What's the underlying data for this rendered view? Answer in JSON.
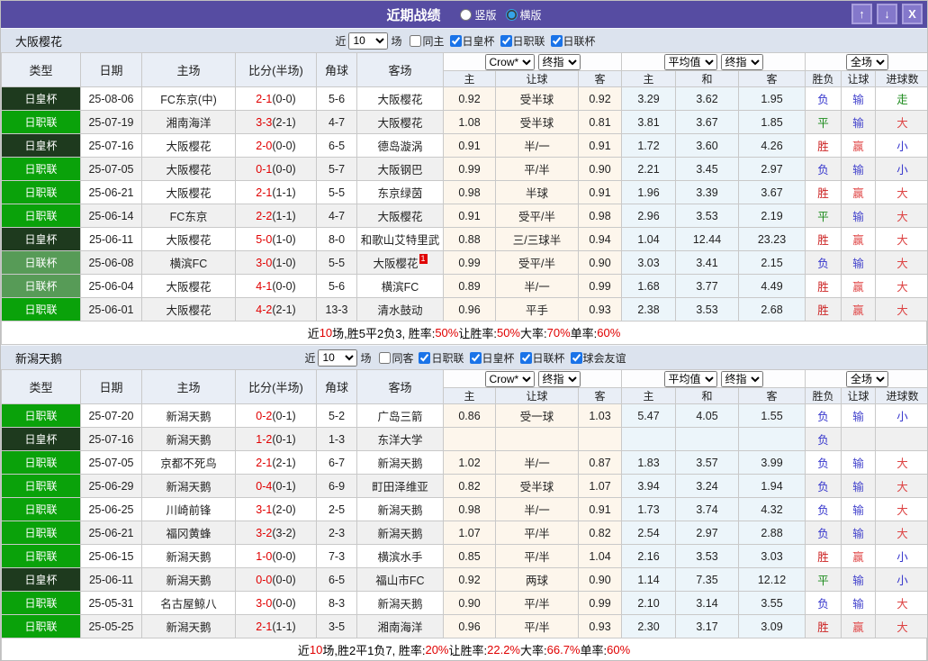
{
  "titlebar": {
    "title": "近期战绩",
    "radios": [
      {
        "label": "竖版",
        "checked": false
      },
      {
        "label": "横版",
        "checked": true
      }
    ],
    "buttons": [
      {
        "glyph": "↑"
      },
      {
        "glyph": "↓"
      },
      {
        "glyph": "X"
      }
    ]
  },
  "colors": {
    "titlebar_bg": "#564ca2",
    "teambar_bg": "#dce3ee",
    "header_bg": "#e9eef6",
    "stripe": "#f0f0f0",
    "handicap_bg": "#fdf6ec",
    "average_bg": "#ecf5fa",
    "self_team": "#008000",
    "score_red": "#e00000",
    "league": {
      "日职联": "#0aa20a",
      "日皇杯": "#1e3a1e",
      "日联杯": "#579b57"
    },
    "outcome": {
      "胜": "#cc2222",
      "平": "#1a8a1a",
      "负": "#3333cc",
      "赢": "#e04848",
      "输": "#4444cc",
      "走": "#1a8a1a",
      "大": "#dd4444",
      "小": "#3333cc"
    }
  },
  "tables": [
    {
      "team": "大阪樱花",
      "filter": {
        "prefix": "近",
        "count": "10",
        "suffix": "场",
        "same": {
          "label": "同主",
          "checked": false
        },
        "leagues": [
          {
            "label": "日皇杯",
            "checked": true
          },
          {
            "label": "日职联",
            "checked": true
          },
          {
            "label": "日联杯",
            "checked": true
          }
        ]
      },
      "selects": [
        "Crow*",
        "终指",
        "平均值",
        "终指",
        "全场"
      ],
      "columns_left": [
        "类型",
        "日期",
        "主场",
        "比分(半场)",
        "角球",
        "客场"
      ],
      "columns_right": [
        "主",
        "让球",
        "客",
        "主",
        "和",
        "客",
        "胜负",
        "让球",
        "进球数"
      ],
      "rows": [
        {
          "league": "日皇杯",
          "date": "25-08-06",
          "home": "FC东京(中)",
          "home_self": false,
          "score": "2-1",
          "half": "(0-0)",
          "corners": "5-6",
          "away": "大阪樱花",
          "away_self": true,
          "badge": "",
          "odds": [
            "0.92",
            "受半球",
            "0.92"
          ],
          "avg": [
            "3.29",
            "3.62",
            "1.95"
          ],
          "outcome": [
            "负",
            "输",
            "走"
          ]
        },
        {
          "league": "日职联",
          "date": "25-07-19",
          "home": "湘南海洋",
          "home_self": false,
          "score": "3-3",
          "half": "(2-1)",
          "corners": "4-7",
          "away": "大阪樱花",
          "away_self": true,
          "badge": "",
          "odds": [
            "1.08",
            "受半球",
            "0.81"
          ],
          "avg": [
            "3.81",
            "3.67",
            "1.85"
          ],
          "outcome": [
            "平",
            "输",
            "大"
          ]
        },
        {
          "league": "日皇杯",
          "date": "25-07-16",
          "home": "大阪樱花",
          "home_self": true,
          "score": "2-0",
          "half": "(0-0)",
          "corners": "6-5",
          "away": "德岛漩涡",
          "away_self": false,
          "badge": "",
          "odds": [
            "0.91",
            "半/一",
            "0.91"
          ],
          "avg": [
            "1.72",
            "3.60",
            "4.26"
          ],
          "outcome": [
            "胜",
            "赢",
            "小"
          ]
        },
        {
          "league": "日职联",
          "date": "25-07-05",
          "home": "大阪樱花",
          "home_self": true,
          "score": "0-1",
          "half": "(0-0)",
          "corners": "5-7",
          "away": "大阪钢巴",
          "away_self": false,
          "badge": "",
          "odds": [
            "0.99",
            "平/半",
            "0.90"
          ],
          "avg": [
            "2.21",
            "3.45",
            "2.97"
          ],
          "outcome": [
            "负",
            "输",
            "小"
          ]
        },
        {
          "league": "日职联",
          "date": "25-06-21",
          "home": "大阪樱花",
          "home_self": true,
          "score": "2-1",
          "half": "(1-1)",
          "corners": "5-5",
          "away": "东京绿茵",
          "away_self": false,
          "badge": "",
          "odds": [
            "0.98",
            "半球",
            "0.91"
          ],
          "avg": [
            "1.96",
            "3.39",
            "3.67"
          ],
          "outcome": [
            "胜",
            "赢",
            "大"
          ]
        },
        {
          "league": "日职联",
          "date": "25-06-14",
          "home": "FC东京",
          "home_self": false,
          "score": "2-2",
          "half": "(1-1)",
          "corners": "4-7",
          "away": "大阪樱花",
          "away_self": true,
          "badge": "",
          "odds": [
            "0.91",
            "受平/半",
            "0.98"
          ],
          "avg": [
            "2.96",
            "3.53",
            "2.19"
          ],
          "outcome": [
            "平",
            "输",
            "大"
          ]
        },
        {
          "league": "日皇杯",
          "date": "25-06-11",
          "home": "大阪樱花",
          "home_self": true,
          "score": "5-0",
          "half": "(1-0)",
          "corners": "8-0",
          "away": "和歌山艾特里武",
          "away_self": false,
          "badge": "",
          "odds": [
            "0.88",
            "三/三球半",
            "0.94"
          ],
          "avg": [
            "1.04",
            "12.44",
            "23.23"
          ],
          "outcome": [
            "胜",
            "赢",
            "大"
          ]
        },
        {
          "league": "日联杯",
          "date": "25-06-08",
          "home": "横滨FC",
          "home_self": false,
          "score": "3-0",
          "half": "(1-0)",
          "corners": "5-5",
          "away": "大阪樱花",
          "away_self": true,
          "badge": "1",
          "odds": [
            "0.99",
            "受平/半",
            "0.90"
          ],
          "avg": [
            "3.03",
            "3.41",
            "2.15"
          ],
          "outcome": [
            "负",
            "输",
            "大"
          ]
        },
        {
          "league": "日联杯",
          "date": "25-06-04",
          "home": "大阪樱花",
          "home_self": true,
          "score": "4-1",
          "half": "(0-0)",
          "corners": "5-6",
          "away": "横滨FC",
          "away_self": false,
          "badge": "",
          "odds": [
            "0.89",
            "半/一",
            "0.99"
          ],
          "avg": [
            "1.68",
            "3.77",
            "4.49"
          ],
          "outcome": [
            "胜",
            "赢",
            "大"
          ]
        },
        {
          "league": "日职联",
          "date": "25-06-01",
          "home": "大阪樱花",
          "home_self": true,
          "score": "4-2",
          "half": "(2-1)",
          "corners": "13-3",
          "away": "清水鼓动",
          "away_self": false,
          "badge": "",
          "odds": [
            "0.96",
            "平手",
            "0.93"
          ],
          "avg": [
            "2.38",
            "3.53",
            "2.68"
          ],
          "outcome": [
            "胜",
            "赢",
            "大"
          ]
        }
      ],
      "summary": [
        [
          "近",
          "k"
        ],
        [
          "10",
          "r"
        ],
        [
          "场,胜5平2负3, 胜率:",
          "k"
        ],
        [
          "50%",
          "r"
        ],
        [
          " 让胜率:",
          "k"
        ],
        [
          "50%",
          "r"
        ],
        [
          " 大率:",
          "k"
        ],
        [
          "70%",
          "r"
        ],
        [
          " 单率:",
          "k"
        ],
        [
          "60%",
          "r"
        ]
      ]
    },
    {
      "team": "新潟天鹅",
      "filter": {
        "prefix": "近",
        "count": "10",
        "suffix": "场",
        "same": {
          "label": "同客",
          "checked": false
        },
        "leagues": [
          {
            "label": "日职联",
            "checked": true
          },
          {
            "label": "日皇杯",
            "checked": true
          },
          {
            "label": "日联杯",
            "checked": true
          },
          {
            "label": "球会友谊",
            "checked": true
          }
        ]
      },
      "selects": [
        "Crow*",
        "终指",
        "平均值",
        "终指",
        "全场"
      ],
      "columns_left": [
        "类型",
        "日期",
        "主场",
        "比分(半场)",
        "角球",
        "客场"
      ],
      "columns_right": [
        "主",
        "让球",
        "客",
        "主",
        "和",
        "客",
        "胜负",
        "让球",
        "进球数"
      ],
      "rows": [
        {
          "league": "日职联",
          "date": "25-07-20",
          "home": "新潟天鹅",
          "home_self": true,
          "score": "0-2",
          "half": "(0-1)",
          "corners": "5-2",
          "away": "广岛三箭",
          "away_self": false,
          "badge": "",
          "odds": [
            "0.86",
            "受一球",
            "1.03"
          ],
          "avg": [
            "5.47",
            "4.05",
            "1.55"
          ],
          "outcome": [
            "负",
            "输",
            "小"
          ]
        },
        {
          "league": "日皇杯",
          "date": "25-07-16",
          "home": "新潟天鹅",
          "home_self": true,
          "score": "1-2",
          "half": "(0-1)",
          "corners": "1-3",
          "away": "东洋大学",
          "away_self": false,
          "badge": "",
          "odds": [
            "",
            "",
            ""
          ],
          "avg": [
            "",
            "",
            ""
          ],
          "outcome": [
            "负",
            "",
            ""
          ]
        },
        {
          "league": "日职联",
          "date": "25-07-05",
          "home": "京都不死鸟",
          "home_self": false,
          "score": "2-1",
          "half": "(2-1)",
          "corners": "6-7",
          "away": "新潟天鹅",
          "away_self": true,
          "badge": "",
          "odds": [
            "1.02",
            "半/一",
            "0.87"
          ],
          "avg": [
            "1.83",
            "3.57",
            "3.99"
          ],
          "outcome": [
            "负",
            "输",
            "大"
          ]
        },
        {
          "league": "日职联",
          "date": "25-06-29",
          "home": "新潟天鹅",
          "home_self": true,
          "score": "0-4",
          "half": "(0-1)",
          "corners": "6-9",
          "away": "町田泽维亚",
          "away_self": false,
          "badge": "",
          "odds": [
            "0.82",
            "受半球",
            "1.07"
          ],
          "avg": [
            "3.94",
            "3.24",
            "1.94"
          ],
          "outcome": [
            "负",
            "输",
            "大"
          ]
        },
        {
          "league": "日职联",
          "date": "25-06-25",
          "home": "川崎前锋",
          "home_self": false,
          "score": "3-1",
          "half": "(2-0)",
          "corners": "2-5",
          "away": "新潟天鹅",
          "away_self": true,
          "badge": "",
          "odds": [
            "0.98",
            "半/一",
            "0.91"
          ],
          "avg": [
            "1.73",
            "3.74",
            "4.32"
          ],
          "outcome": [
            "负",
            "输",
            "大"
          ]
        },
        {
          "league": "日职联",
          "date": "25-06-21",
          "home": "福冈黄蜂",
          "home_self": false,
          "score": "3-2",
          "half": "(3-2)",
          "corners": "2-3",
          "away": "新潟天鹅",
          "away_self": true,
          "badge": "",
          "odds": [
            "1.07",
            "平/半",
            "0.82"
          ],
          "avg": [
            "2.54",
            "2.97",
            "2.88"
          ],
          "outcome": [
            "负",
            "输",
            "大"
          ]
        },
        {
          "league": "日职联",
          "date": "25-06-15",
          "home": "新潟天鹅",
          "home_self": true,
          "score": "1-0",
          "half": "(0-0)",
          "corners": "7-3",
          "away": "横滨水手",
          "away_self": false,
          "badge": "",
          "odds": [
            "0.85",
            "平/半",
            "1.04"
          ],
          "avg": [
            "2.16",
            "3.53",
            "3.03"
          ],
          "outcome": [
            "胜",
            "赢",
            "小"
          ]
        },
        {
          "league": "日皇杯",
          "date": "25-06-11",
          "home": "新潟天鹅",
          "home_self": true,
          "score": "0-0",
          "half": "(0-0)",
          "corners": "6-5",
          "away": "福山市FC",
          "away_self": false,
          "badge": "",
          "odds": [
            "0.92",
            "两球",
            "0.90"
          ],
          "avg": [
            "1.14",
            "7.35",
            "12.12"
          ],
          "outcome": [
            "平",
            "输",
            "小"
          ]
        },
        {
          "league": "日职联",
          "date": "25-05-31",
          "home": "名古屋鲸八",
          "home_self": false,
          "score": "3-0",
          "half": "(0-0)",
          "corners": "8-3",
          "away": "新潟天鹅",
          "away_self": true,
          "badge": "",
          "odds": [
            "0.90",
            "平/半",
            "0.99"
          ],
          "avg": [
            "2.10",
            "3.14",
            "3.55"
          ],
          "outcome": [
            "负",
            "输",
            "大"
          ]
        },
        {
          "league": "日职联",
          "date": "25-05-25",
          "home": "新潟天鹅",
          "home_self": true,
          "score": "2-1",
          "half": "(1-1)",
          "corners": "3-5",
          "away": "湘南海洋",
          "away_self": false,
          "badge": "",
          "odds": [
            "0.96",
            "平/半",
            "0.93"
          ],
          "avg": [
            "2.30",
            "3.17",
            "3.09"
          ],
          "outcome": [
            "胜",
            "赢",
            "大"
          ]
        }
      ],
      "summary": [
        [
          "近",
          "k"
        ],
        [
          "10",
          "r"
        ],
        [
          "场,胜2平1负7, 胜率:",
          "k"
        ],
        [
          "20%",
          "r"
        ],
        [
          " 让胜率:",
          "k"
        ],
        [
          "22.2%",
          "r"
        ],
        [
          " 大率:",
          "k"
        ],
        [
          "66.7%",
          "r"
        ],
        [
          " 单率:",
          "k"
        ],
        [
          "60%",
          "r"
        ]
      ]
    }
  ]
}
